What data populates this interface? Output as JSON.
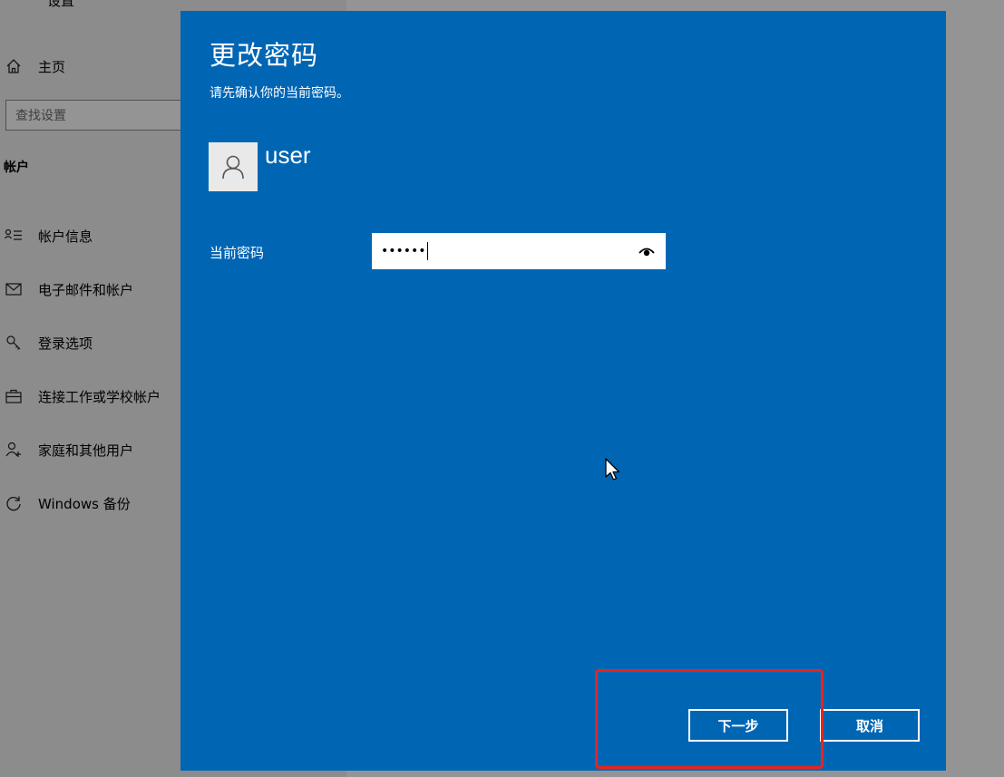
{
  "sidebar": {
    "top_label": "设置",
    "home_label": "主页",
    "search_placeholder": "查找设置",
    "section_title": "帐户",
    "items": [
      {
        "label": "帐户信息",
        "icon": "account-info-icon"
      },
      {
        "label": "电子邮件和帐户",
        "icon": "mail-icon"
      },
      {
        "label": "登录选项",
        "icon": "key-icon"
      },
      {
        "label": "连接工作或学校帐户",
        "icon": "briefcase-icon"
      },
      {
        "label": "家庭和其他用户",
        "icon": "add-person-icon"
      },
      {
        "label": "Windows 备份",
        "icon": "sync-icon"
      }
    ]
  },
  "dialog": {
    "title": "更改密码",
    "subtitle": "请先确认你的当前密码。",
    "user_name": "user",
    "field_label": "当前密码",
    "password_masked": "••••••",
    "next_label": "下一步",
    "cancel_label": "取消"
  },
  "colors": {
    "dialog_bg": "#0066b4",
    "highlight": "#e8241c",
    "sidebar_bg": "#f2f2f2"
  }
}
